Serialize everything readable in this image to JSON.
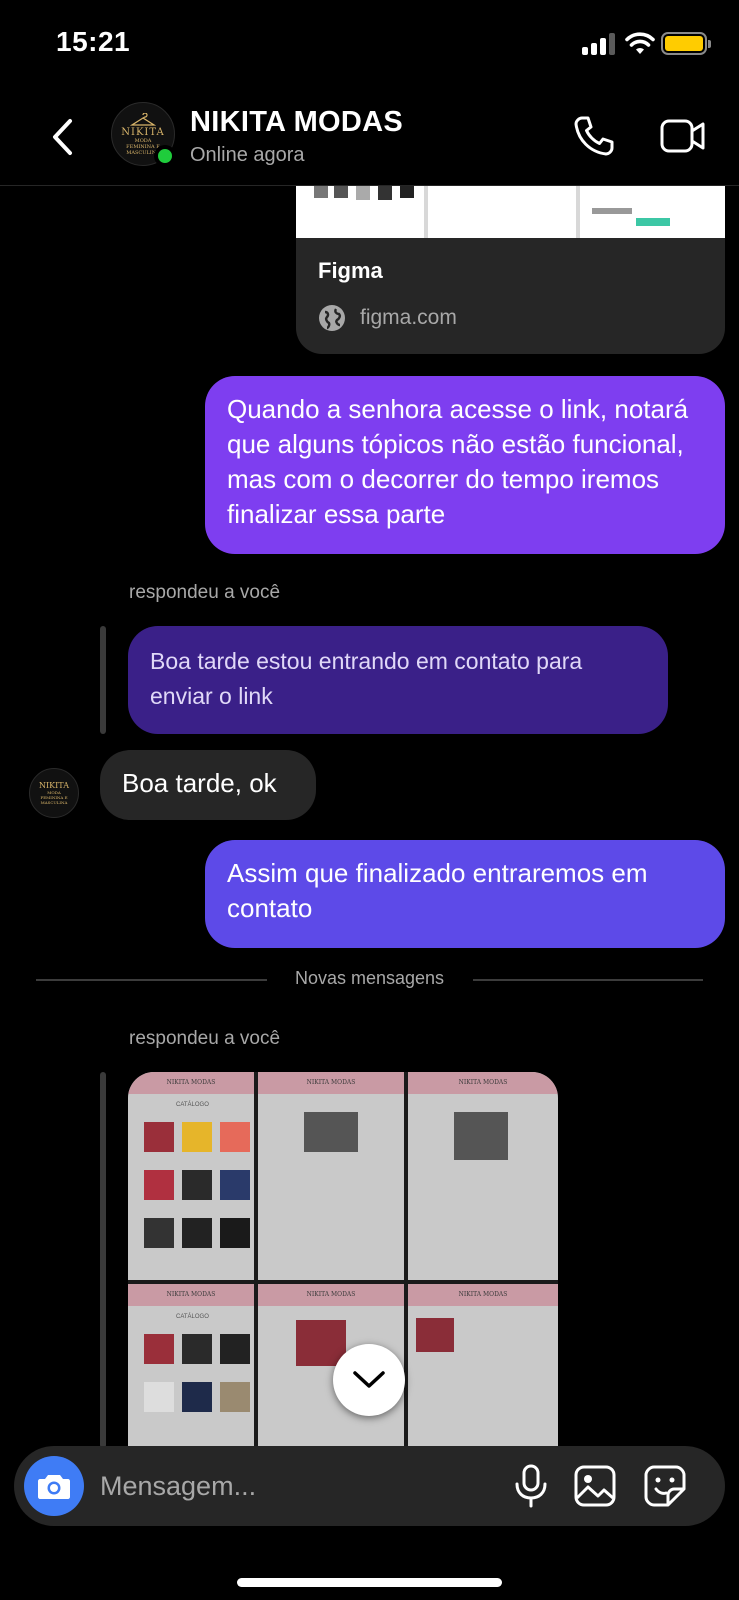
{
  "status_bar": {
    "time": "15:21"
  },
  "header": {
    "contact_name": "NIKITA MODAS",
    "status": "Online agora",
    "avatar_logo": {
      "main": "NIKITA",
      "sub": "MODA FEMININA E MASCULINA"
    }
  },
  "link_preview": {
    "title": "Figma",
    "domain": "figma.com"
  },
  "messages": {
    "out_1": "Quando a senhora acesse o link, notará que alguns tópicos não estão funcional, mas com o decorrer do tempo iremos finalizar essa parte",
    "reply_label_1": "respondeu a você",
    "quoted_1": "Boa tarde estou entrando em contato para enviar o link",
    "in_1": "Boa tarde, ok",
    "out_2": "Assim que finalizado entraremos em contato",
    "divider": "Novas mensagens",
    "reply_label_2": "respondeu a você"
  },
  "image_reply": {
    "page_header": "NIKITA MODAS",
    "section_title": "CATÁLOGO"
  },
  "composer": {
    "placeholder": "Mensagem..."
  },
  "colors": {
    "outgoing_purple": "#7e3ef0",
    "outgoing_indigo": "#5d4ae8",
    "quoted_bubble": "#3a2088",
    "incoming_bubble": "#262626",
    "online_green": "#1fcc3c",
    "camera_blue": "#3f7cf5",
    "battery_yellow": "#ffcc00"
  },
  "icons": [
    "back-icon",
    "phone-icon",
    "video-camera-icon",
    "globe-icon",
    "chevron-down-icon",
    "camera-icon",
    "microphone-icon",
    "gallery-icon",
    "sticker-icon"
  ]
}
